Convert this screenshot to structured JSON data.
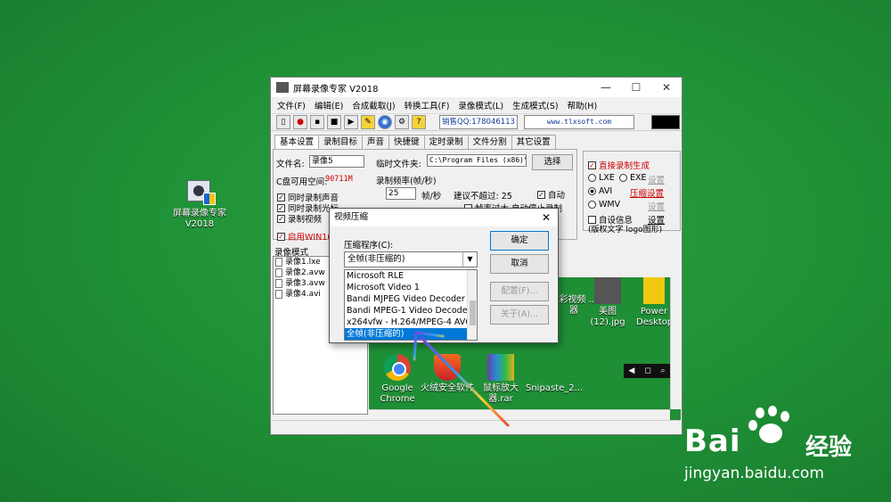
{
  "desktop": {
    "icon_label": "屏幕录像专家V2018"
  },
  "window": {
    "title": "屏幕录像专家 V2018",
    "controls": [
      "—",
      "☐",
      "✕"
    ],
    "menu": [
      "文件(F)",
      "编辑(E)",
      "合成截取(J)",
      "转换工具(F)",
      "录像模式(L)",
      "生成模式(S)",
      "帮助(H)"
    ],
    "sales_qq": "销售QQ:178046113",
    "website": "www.tlxsoft.com",
    "tabs": [
      "基本设置",
      "录制目标",
      "声音",
      "快捷键",
      "定时录制",
      "文件分割",
      "其它设置"
    ],
    "basic": {
      "filename_label": "文件名:",
      "filename_value": "录像5",
      "tempdir_label": "临时文件夹:",
      "tempdir_value": "C:\\Program Files (x86)\\",
      "choose_button": "选择",
      "disk_label": "C盘可用空间:",
      "disk_value": "90711M",
      "chk_sound": "同时录制声音",
      "chk_cursor": "同时录制光标",
      "chk_video": "录制视频",
      "chk_win10": "启用WIN10新",
      "fps_label": "录制频率(帧/秒)",
      "fps_value": "25",
      "fps_unit": "帧/秒",
      "fps_suggest": "建议不超过: 25",
      "auto_label": "自动",
      "stop_label": "帧率过大,自动停止录制"
    },
    "right_panel": {
      "direct_label": "直接录制生成",
      "lxe": "LXE",
      "exe": "EXE",
      "settings1": "设置",
      "avi": "AVI",
      "compress_settings": "压缩设置",
      "wmv": "WMV",
      "settings2": "设置",
      "custom_info": "自设信息",
      "settings3": "设置",
      "custom_note": "(版权文字 logo图形)"
    },
    "list_header": "录像模式",
    "recordings": [
      "录像1.lxe",
      "录像2.avw",
      "录像3.avw",
      "录像4.avi"
    ],
    "preview_icons": [
      {
        "label": "Google Chrome"
      },
      {
        "label": "火绒安全软件"
      },
      {
        "label": "鼠标放大器.rar"
      },
      {
        "label": "Snipaste_2..."
      },
      {
        "label": "美图 (12).jpg"
      },
      {
        "label": "Power Desktop"
      },
      {
        "label": "...彩视频 ...器"
      }
    ],
    "preview_toolbar": [
      "◀",
      "◻",
      "⌕"
    ]
  },
  "dialog": {
    "title": "视频压缩",
    "compressor_label": "压缩程序(C):",
    "selected": "全帧(非压缩的)",
    "options": [
      "Microsoft RLE",
      "Microsoft Video 1",
      "Bandi MJPEG Video Decoder",
      "Bandi MPEG-1 Video Decoder",
      "x264vfw - H.264/MPEG-4 AVC",
      "全帧(非压缩的)"
    ],
    "ok_button": "确定",
    "cancel_button": "取消",
    "config_button": "配置(F)...",
    "about_button": "关于(A)..."
  },
  "watermark": {
    "brand": "Bai",
    "brand_cn": "经验",
    "url": "jingyan.baidu.com"
  }
}
